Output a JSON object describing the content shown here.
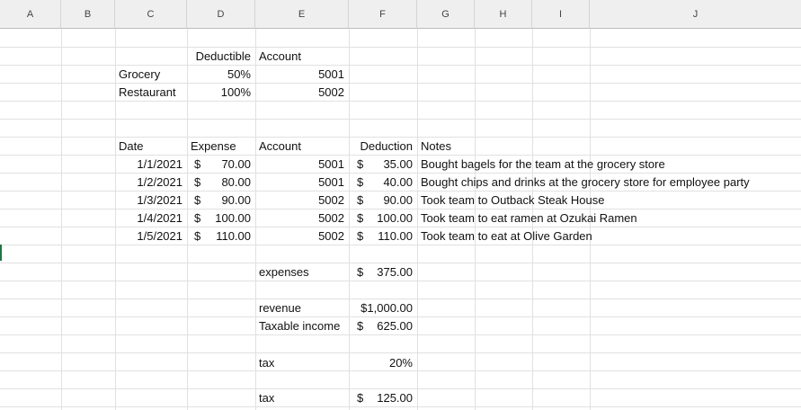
{
  "columns": [
    "A",
    "B",
    "C",
    "D",
    "E",
    "F",
    "G",
    "H",
    "I",
    "J"
  ],
  "rate_table": {
    "headers": {
      "deductible": "Deductible",
      "account": "Account"
    },
    "rows": [
      {
        "category": "Grocery",
        "deductible": "50%",
        "account": "5001"
      },
      {
        "category": "Restaurant",
        "deductible": "100%",
        "account": "5002"
      }
    ]
  },
  "expense_table": {
    "headers": {
      "date": "Date",
      "expense": "Expense",
      "account": "Account",
      "deduction": "Deduction",
      "notes": "Notes"
    },
    "currency_symbol": "$",
    "rows": [
      {
        "date": "1/1/2021",
        "expense": "70.00",
        "account": "5001",
        "deduction": "35.00",
        "notes": "Bought bagels for the team at the grocery store"
      },
      {
        "date": "1/2/2021",
        "expense": "80.00",
        "account": "5001",
        "deduction": "40.00",
        "notes": "Bought chips and drinks at the grocery store for employee party"
      },
      {
        "date": "1/3/2021",
        "expense": "90.00",
        "account": "5002",
        "deduction": "90.00",
        "notes": "Took team to Outback Steak House"
      },
      {
        "date": "1/4/2021",
        "expense": "100.00",
        "account": "5002",
        "deduction": "100.00",
        "notes": "Took team to eat ramen at Ozukai Ramen"
      },
      {
        "date": "1/5/2021",
        "expense": "110.00",
        "account": "5002",
        "deduction": "110.00",
        "notes": "Took team to eat at Olive Garden"
      }
    ]
  },
  "summary": {
    "expenses_label": "expenses",
    "expenses_value": "375.00",
    "revenue_label": "revenue",
    "revenue_value": "$1,000.00",
    "taxable_label": "Taxable income",
    "taxable_value": "625.00",
    "tax_rate_label": "tax",
    "tax_rate_value": "20%",
    "tax_label": "tax",
    "tax_value": "125.00"
  },
  "colors": {
    "header_bg": "#efefef",
    "gridline": "#e1e1e1",
    "active_marker": "#217346"
  }
}
